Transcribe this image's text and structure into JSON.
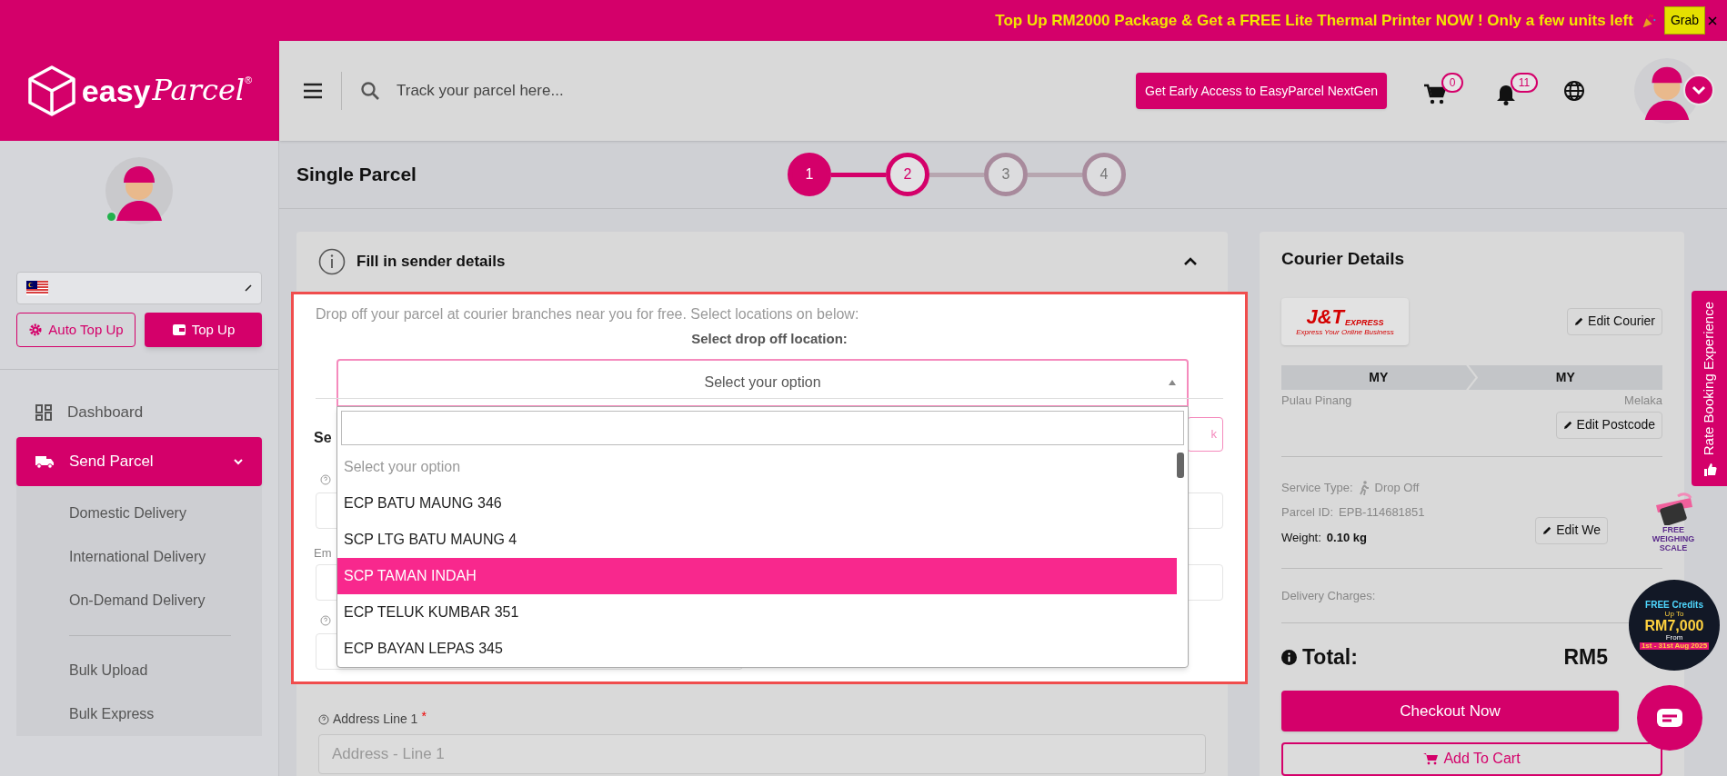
{
  "banner": {
    "message": "Top Up RM2000 Package & Get a FREE Lite Thermal Printer NOW ! Only a few units left",
    "button": "Grab"
  },
  "logo": {
    "word": "easy",
    "script": "Parcel",
    "mark": "®"
  },
  "header": {
    "search_placeholder": "Track your parcel here...",
    "promo_button": "Get Early Access to EasyParcel NextGen",
    "cart_count": "0",
    "notification_count": "11"
  },
  "sidebar": {
    "online": true,
    "wallet_buttons": [
      {
        "label": "Auto Top Up",
        "kind": "outline"
      },
      {
        "label": "Top Up",
        "kind": "solid"
      }
    ],
    "menu": [
      {
        "label": "Dashboard",
        "kind": "dashboard",
        "selected": false
      },
      {
        "label": "Send Parcel",
        "kind": "truck",
        "selected": true,
        "expanded": true,
        "child_groups": [
          [
            {
              "label": "Domestic Delivery"
            },
            {
              "label": "International Delivery"
            },
            {
              "label": "On-Demand Delivery"
            }
          ],
          [
            {
              "label": "Bulk Upload"
            },
            {
              "label": "Bulk Express"
            }
          ]
        ]
      }
    ]
  },
  "page": {
    "title": "Single Parcel",
    "steps": [
      {
        "label": "1",
        "done": true,
        "current": false
      },
      {
        "label": "2",
        "done": false,
        "current": true
      },
      {
        "label": "3",
        "done": false,
        "current": false
      },
      {
        "label": "4",
        "done": false,
        "current": false
      }
    ]
  },
  "sender": {
    "title": "Fill in sender details",
    "expanded": true,
    "hint": "Drop off your parcel at courier branches near you for free. Select locations on below:",
    "location_label": "Select drop off location:",
    "select": {
      "placeholder": "Select your option",
      "open": true
    },
    "options": [
      {
        "label": "Select your option",
        "kind": "placeholder",
        "selected": false
      },
      {
        "label": "ECP BATU MAUNG 346",
        "kind": "option",
        "selected": false
      },
      {
        "label": "SCP LTG BATU MAUNG 4",
        "kind": "option",
        "selected": false
      },
      {
        "label": "SCP TAMAN INDAH",
        "kind": "option",
        "selected": true
      },
      {
        "label": "ECP TELUK KUMBAR 351",
        "kind": "option",
        "selected": false
      },
      {
        "label": "ECP BAYAN LEPAS 345",
        "kind": "option",
        "selected": false
      }
    ],
    "covered": {
      "section_title": "Se",
      "email_label": "Em",
      "button": "k"
    },
    "address": {
      "label": "Address Line 1",
      "required_mark": "*",
      "placeholder": "Address - Line 1"
    }
  },
  "courier": {
    "title": "Courier Details",
    "logo": {
      "name": "J&T",
      "tag": "EXPRESS",
      "slogan": "Express Your Online Business"
    },
    "edit_courier": "Edit Courier",
    "route": {
      "from": "MY",
      "to": "MY",
      "from_city": "Pulau Pinang",
      "to_city": "Melaka"
    },
    "edit_postcode": "Edit Postcode",
    "details": [
      {
        "label": "Service Type:",
        "value": "Drop Off",
        "kind": "service"
      },
      {
        "label": "Parcel ID:",
        "value": "EPB-114681851",
        "kind": "plain"
      },
      {
        "label": "Weight:",
        "value": "0.10 kg",
        "kind": "strong"
      }
    ],
    "edit_weight": "Edit We",
    "charges_label": "Delivery Charges:",
    "total_label": "Total:",
    "total_value": "RM5",
    "checkout": "Checkout Now",
    "add_to_cart": "Add To Cart"
  },
  "promos": {
    "scale": [
      "FREE",
      "WEIGHING",
      "SCALE"
    ],
    "credits": {
      "title": "FREE Credits",
      "prefix": "Up To",
      "amount": "RM7,000",
      "from": "From",
      "dates": "1st - 31st Aug 2025"
    }
  },
  "feedback_tab": "Rate Booking Experience"
}
